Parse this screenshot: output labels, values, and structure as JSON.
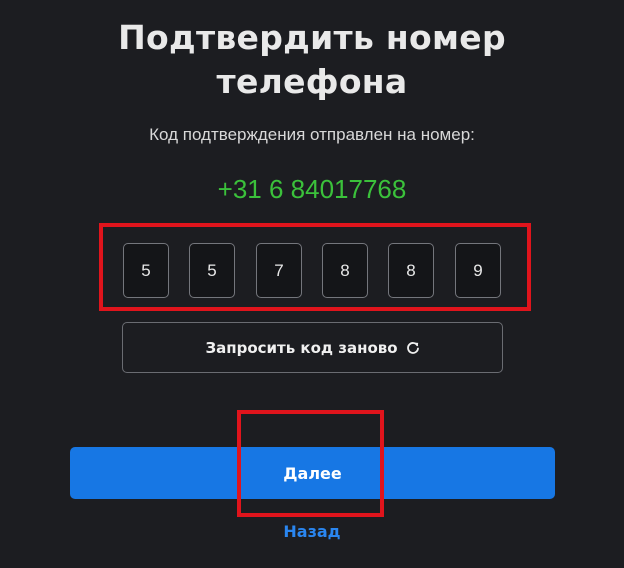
{
  "page": {
    "title_line1": "Подтвердить номер",
    "title_line2": "телефона",
    "subtitle": "Код подтверждения отправлен на номер:",
    "phone_number": "+31 6 84017768"
  },
  "code_inputs": [
    "5",
    "5",
    "7",
    "8",
    "8",
    "9"
  ],
  "resend": {
    "label": "Запросить код заново",
    "icon": "refresh-icon"
  },
  "next_button": {
    "label": "Далее"
  },
  "back_link": {
    "label": "Назад"
  },
  "colors": {
    "background": "#1c1d21",
    "phone": "#3bc13b",
    "primary": "#1777e4",
    "link": "#2a86f0",
    "highlight": "#e0141c"
  }
}
